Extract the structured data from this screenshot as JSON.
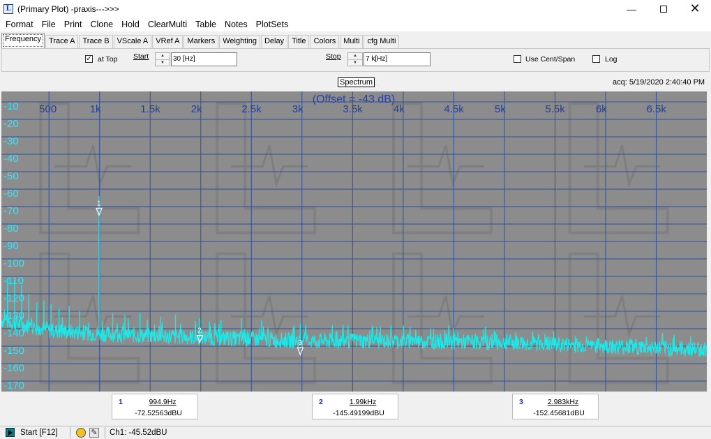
{
  "window": {
    "app_icon": "L",
    "title": "(Primary Plot) -praxis--->>>",
    "min_glyph": "—",
    "close_glyph": "✕"
  },
  "menu": [
    "Format",
    "File",
    "Print",
    "Clone",
    "Hold",
    "ClearMulti",
    "Table",
    "Notes",
    "PlotSets"
  ],
  "tabs": [
    {
      "label": "Frequency",
      "active": true
    },
    {
      "label": "Trace A"
    },
    {
      "label": "Trace B"
    },
    {
      "label": "VScale A"
    },
    {
      "label": "VRef A"
    },
    {
      "label": "Markers"
    },
    {
      "label": "Weighting"
    },
    {
      "label": "Delay"
    },
    {
      "label": "Title"
    },
    {
      "label": "Colors"
    },
    {
      "label": "Multi"
    },
    {
      "label": "cfg Multi"
    }
  ],
  "frequency_panel": {
    "at_top_label": "at Top",
    "at_top_checked": true,
    "check_mark": "✓",
    "start_label": "Start",
    "start_value": "30 [Hz]",
    "stop_label": "Stop",
    "stop_value": "7 k[Hz]",
    "use_cent_span_label": "Use Cent/Span",
    "use_cent_span_checked": false,
    "log_label": "Log",
    "log_checked": false,
    "spin_up": "▲",
    "spin_down": "▼"
  },
  "graph": {
    "title": "Spectrum",
    "acq": "acq: 5/19/2020 2:40:40 PM",
    "offset_label": "(Offset = -43 dB)"
  },
  "chart_data": {
    "type": "line",
    "title": "Spectrum",
    "xlabel": "",
    "ylabel": "",
    "x_ticks": [
      "500",
      "1k",
      "1.5k",
      "2k",
      "2.5k",
      "3k",
      "3.5k",
      "4k",
      "4.5k",
      "5k",
      "5.5k",
      "6k",
      "6.5k"
    ],
    "x_tick_values": [
      500,
      1000,
      1500,
      2000,
      2500,
      3000,
      3500,
      4000,
      4500,
      5000,
      5500,
      6000,
      6500
    ],
    "y_ticks": [
      "-10",
      "-20",
      "-30",
      "-40",
      "-50",
      "-60",
      "-70",
      "-80",
      "-90",
      "-100",
      "-110",
      "-120",
      "-130",
      "-140",
      "-150",
      "-160",
      "-170"
    ],
    "y_tick_values": [
      -10,
      -20,
      -30,
      -40,
      -50,
      -60,
      -70,
      -80,
      -90,
      -100,
      -110,
      -120,
      -130,
      -140,
      -150,
      -160,
      -170
    ],
    "xlim": [
      30,
      7000
    ],
    "ylim": [
      -176,
      -4
    ],
    "grid": true,
    "colors": {
      "background": "#8c8c8c",
      "grid": "#2e4f9b",
      "x_tick_text": "#1f3f9a",
      "y_tick_text": "#2fe7ff",
      "trace": "#21e6e6",
      "offset_text": "#2742a8"
    },
    "noise_floor": [
      {
        "x": 30,
        "y": -135
      },
      {
        "x": 500,
        "y": -141
      },
      {
        "x": 1000,
        "y": -143
      },
      {
        "x": 2000,
        "y": -145
      },
      {
        "x": 3000,
        "y": -147
      },
      {
        "x": 4000,
        "y": -147
      },
      {
        "x": 5000,
        "y": -148
      },
      {
        "x": 6000,
        "y": -150
      },
      {
        "x": 7000,
        "y": -152
      }
    ],
    "spikes": [
      {
        "x": 90,
        "y": -111
      },
      {
        "x": 160,
        "y": -112
      },
      {
        "x": 230,
        "y": -115
      },
      {
        "x": 300,
        "y": -120
      },
      {
        "x": 380,
        "y": -125
      },
      {
        "x": 450,
        "y": -124
      },
      {
        "x": 520,
        "y": -126
      },
      {
        "x": 600,
        "y": -128
      },
      {
        "x": 700,
        "y": -127
      },
      {
        "x": 800,
        "y": -130
      },
      {
        "x": 994.9,
        "y": -64
      },
      {
        "x": 1130,
        "y": -131
      },
      {
        "x": 1250,
        "y": -132
      },
      {
        "x": 1400,
        "y": -131
      },
      {
        "x": 1600,
        "y": -133
      },
      {
        "x": 1750,
        "y": -132
      },
      {
        "x": 1990,
        "y": -134
      },
      {
        "x": 2200,
        "y": -135
      },
      {
        "x": 2400,
        "y": -134
      },
      {
        "x": 2600,
        "y": -135
      },
      {
        "x": 2983,
        "y": -137
      },
      {
        "x": 3300,
        "y": -138
      },
      {
        "x": 3700,
        "y": -139
      },
      {
        "x": 4300,
        "y": -140
      },
      {
        "x": 4900,
        "y": -141
      },
      {
        "x": 5400,
        "y": -143
      },
      {
        "x": 5700,
        "y": -144
      },
      {
        "x": 6300,
        "y": -146
      },
      {
        "x": 6800,
        "y": -149
      }
    ],
    "markers": [
      {
        "label": "1",
        "x": 994.9,
        "y": -72.52563
      },
      {
        "label": "2",
        "x": 1990,
        "y": -145.49199
      },
      {
        "label": "3",
        "x": 2983,
        "y": -152.45681
      }
    ]
  },
  "readouts": [
    {
      "num": "1",
      "freq": "994.9Hz",
      "level": "-72.52563dBU"
    },
    {
      "num": "2",
      "freq": "1.99kHz",
      "level": "-145.49199dBU"
    },
    {
      "num": "3",
      "freq": "2.983kHz",
      "level": "-152.45681dBU"
    }
  ],
  "status": {
    "start": "Start [F12]",
    "tool_glyph": "✎",
    "channel_reading": "Ch1: -45.52dBU"
  }
}
